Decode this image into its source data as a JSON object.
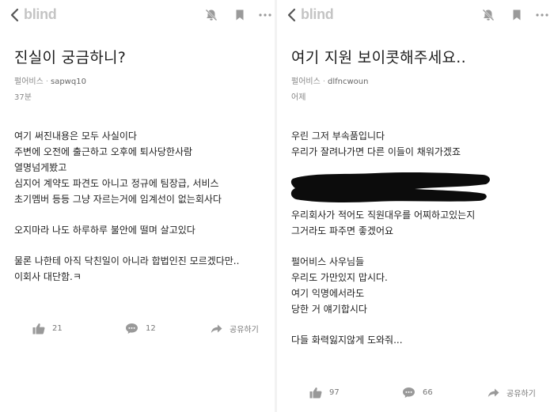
{
  "app": {
    "brand": "blind"
  },
  "colors": {
    "icon": "#9a9a9a",
    "brand": "#c4c4c4",
    "redaction": "#0c0c0c"
  },
  "posts": [
    {
      "title": "진실이 궁금하니?",
      "company": "펄어비스",
      "separator": "·",
      "username": "sapwq10",
      "time": "37분",
      "body_lines": [
        "여기 써진내용은 모두 사실이다",
        "주변에 오전에 출근하고 오후에 퇴사당한사람",
        "열명넘게봤고",
        "심지어 계약도 파견도 아니고 정규에 팀장급, 서비스",
        "초기멤버 등등 그냥 자르는거에 임계선이 없는회사다",
        "",
        "오지마라 나도 하루하루 불안에 떨며 살고있다",
        "",
        "물론 나한테 아직 닥친일이 아니라 합법인진 모르겠다만..",
        "이회사 대단함.ㅋ"
      ],
      "likes": "21",
      "comments": "12",
      "share_label": "공유하기"
    },
    {
      "title": "여기 지원 보이콧해주세요..",
      "company": "펄어비스",
      "separator": "·",
      "username": "dlfncwoun",
      "time": "어제",
      "body_lines_a": [
        "우린 그저 부속품입니다",
        "우리가 잘려나가면 다른 이들이 채워가겠죠"
      ],
      "body_lines_b": [
        "우리회사가 적어도 직원대우를 어찌하고있는지",
        "그거라도 파주면 좋겠어요",
        "",
        "펄어비스 사우님들",
        "우리도 가만있지 맙시다.",
        "여기 익명에서라도",
        "당한 거 얘기합시다",
        "",
        "다들 화력잃지않게 도와줘..."
      ],
      "likes": "97",
      "comments": "66",
      "share_label": "공유하기"
    }
  ],
  "icons": {
    "back": "chevron-left-icon",
    "notify_off": "bell-off-icon",
    "bookmark": "bookmark-icon",
    "more": "more-horizontal-icon",
    "like": "thumbs-up-icon",
    "comment": "comment-bubble-icon",
    "share": "share-arrow-icon"
  }
}
